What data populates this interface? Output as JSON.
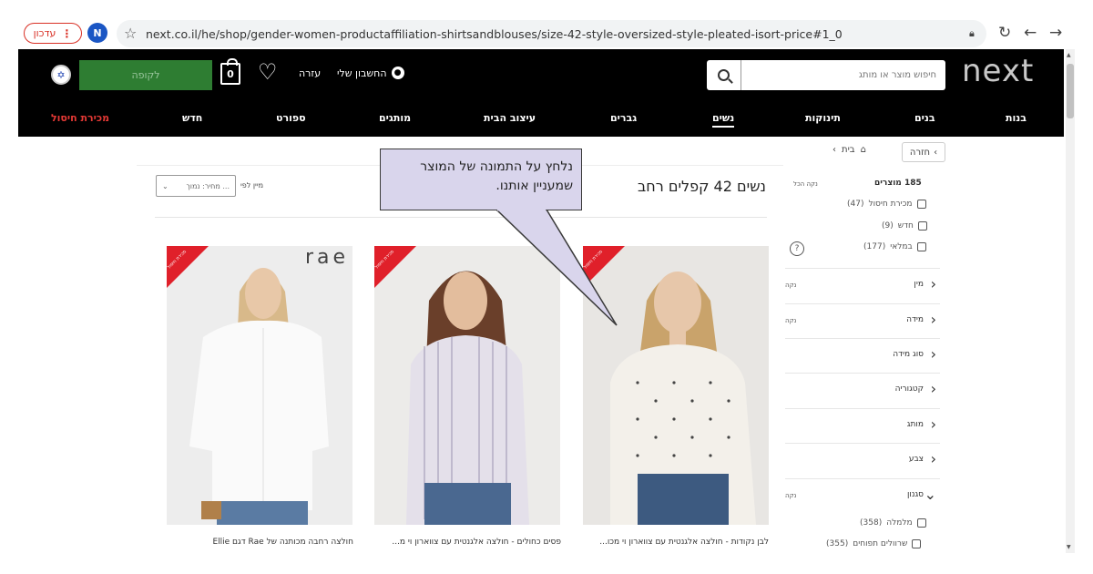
{
  "browser": {
    "update_label": "עדכון",
    "profile_initial": "N",
    "url": "next.co.il/he/shop/gender-women-productaffiliation-shirtsandblouses/size-42-style-oversized-style-pleated-isort-price#1_0"
  },
  "header": {
    "logo": "next",
    "search_placeholder": "חיפוש מוצר או מותג",
    "account_label": "החשבון שלי",
    "help_label": "עזרה",
    "basket_label": "לקופה",
    "bag_count": "0"
  },
  "nav": {
    "items": [
      "בנות",
      "בנים",
      "תינוקות",
      "נשים",
      "גברים",
      "עיצוב הבית",
      "מותגים",
      "ספורט",
      "חדש",
      "מכירת חיסול"
    ]
  },
  "breadcrumb": {
    "back_label": "חזרה",
    "home_label": "בית"
  },
  "listing": {
    "title": "נשים 42 קפלים רחב",
    "sort_label": "מיין לפי",
    "sort_value": "מחיר: נמוך ..."
  },
  "filters": {
    "count_label": "185 מוצרים",
    "clear_all": "נקה הכל",
    "checks": [
      {
        "label": "מכירת חיסול",
        "count": "(47)"
      },
      {
        "label": "חדש",
        "count": "(9)"
      },
      {
        "label": "במלאי",
        "count": "(177)"
      }
    ],
    "sections": [
      {
        "label": "מין",
        "clear": "נקה"
      },
      {
        "label": "מידה",
        "clear": "נקה"
      },
      {
        "label": "סוג מידה",
        "clear": ""
      },
      {
        "label": "קטגוריה",
        "clear": ""
      },
      {
        "label": "מותג",
        "clear": ""
      },
      {
        "label": "צבע",
        "clear": ""
      },
      {
        "label": "סגנון",
        "clear": "נקה"
      }
    ],
    "style_checks": [
      {
        "label": "מלמלה",
        "count": "(358)"
      },
      {
        "label": "שרוולים תפוחים",
        "count": "(355)"
      }
    ],
    "help_glyph": "?"
  },
  "products": [
    {
      "title": "לבן נקודות - חולצה אלגנטית עם צווארון וי מכו...",
      "badge": "מכירת חיסול",
      "brand": ""
    },
    {
      "title": "פסים כחולים - חולצה אלגנטית עם צווארון וי מ...",
      "badge": "מכירת חיסול",
      "brand": ""
    },
    {
      "title": "חולצה רחבה מכותנה של Rae דגם Ellie",
      "badge": "מכירת חיסול",
      "brand": "rae"
    }
  ],
  "callout": {
    "line1": "נלחץ על התמונה של המוצר",
    "line2": "שמעניין אותנו."
  },
  "colors": {
    "header_bg": "#000000",
    "basket_green": "#2e7d32",
    "sale_red": "#e53935",
    "callout_bg": "#d9d5ec"
  }
}
